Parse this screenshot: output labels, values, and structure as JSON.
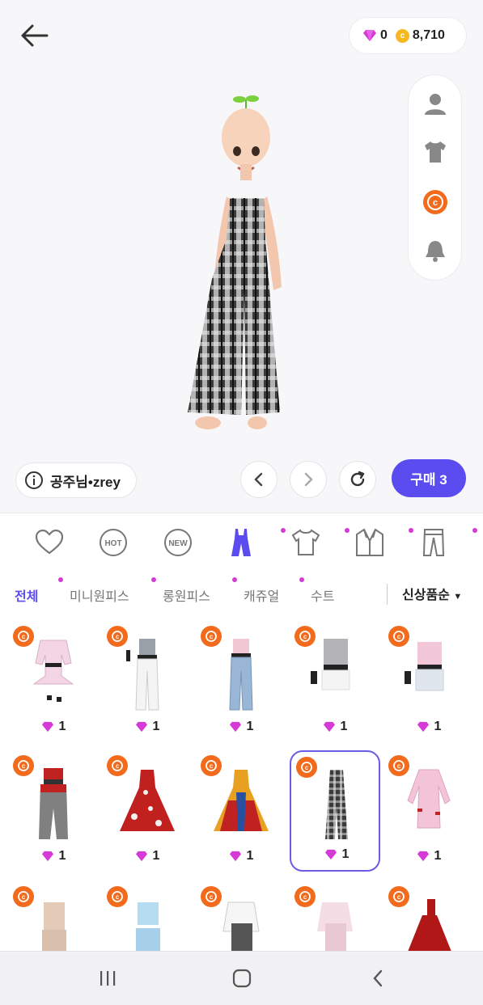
{
  "header": {
    "gems": "0",
    "coins": "8,710"
  },
  "profile": {
    "nickname": "공주님•zrey"
  },
  "actions": {
    "buy_label": "구매 3"
  },
  "subtabs": [
    {
      "label": "전체",
      "active": true
    },
    {
      "label": "미니원피스"
    },
    {
      "label": "롱원피스"
    },
    {
      "label": "캐쥬얼"
    },
    {
      "label": "수트"
    }
  ],
  "sort": {
    "label": "신상품순"
  },
  "items": [
    {
      "price": "1"
    },
    {
      "price": "1"
    },
    {
      "price": "1"
    },
    {
      "price": "1"
    },
    {
      "price": "1"
    },
    {
      "price": "1"
    },
    {
      "price": "1"
    },
    {
      "price": "1"
    },
    {
      "price": "1"
    },
    {
      "price": "1"
    }
  ],
  "colors": {
    "accent": "#5b4cf0",
    "badge": "#f26a1b",
    "gem": "#d63ad6",
    "coin": "#f5b820"
  }
}
